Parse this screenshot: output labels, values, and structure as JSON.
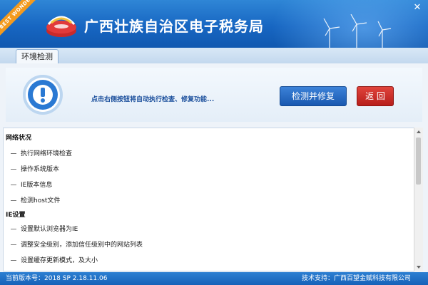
{
  "window": {
    "title": "广西壮族自治区电子税务局",
    "ribbon": "BEST WONDER",
    "close_icon": "close-icon"
  },
  "tabs": [
    {
      "label": "环境检测",
      "active": true
    }
  ],
  "banner": {
    "hint": "点击右侧按钮将自动执行检查、修复功能...",
    "repair_button": "检测并修复",
    "back_button": "返  回",
    "icon": "exclamation-icon"
  },
  "checklist": {
    "groups": [
      {
        "title": "网络状况",
        "items": [
          "执行网络环境检查",
          "操作系统版本",
          "IE版本信息",
          "检测host文件"
        ]
      },
      {
        "title": "IE设置",
        "items": [
          "设置默认浏览器为IE",
          "调整安全级别，添加信任级别中的网站列表",
          "设置缓存更新模式，及大小"
        ]
      }
    ]
  },
  "status": {
    "version_label": "当前版本号：2018 SP 2.18.11.06",
    "support_label": "技术支持：广西百望金赋科技有限公司"
  },
  "colors": {
    "title_bar": "#1766c2",
    "repair_button": "#1958b0",
    "back_button": "#b71e1b",
    "ribbon": "#f39a1e"
  }
}
